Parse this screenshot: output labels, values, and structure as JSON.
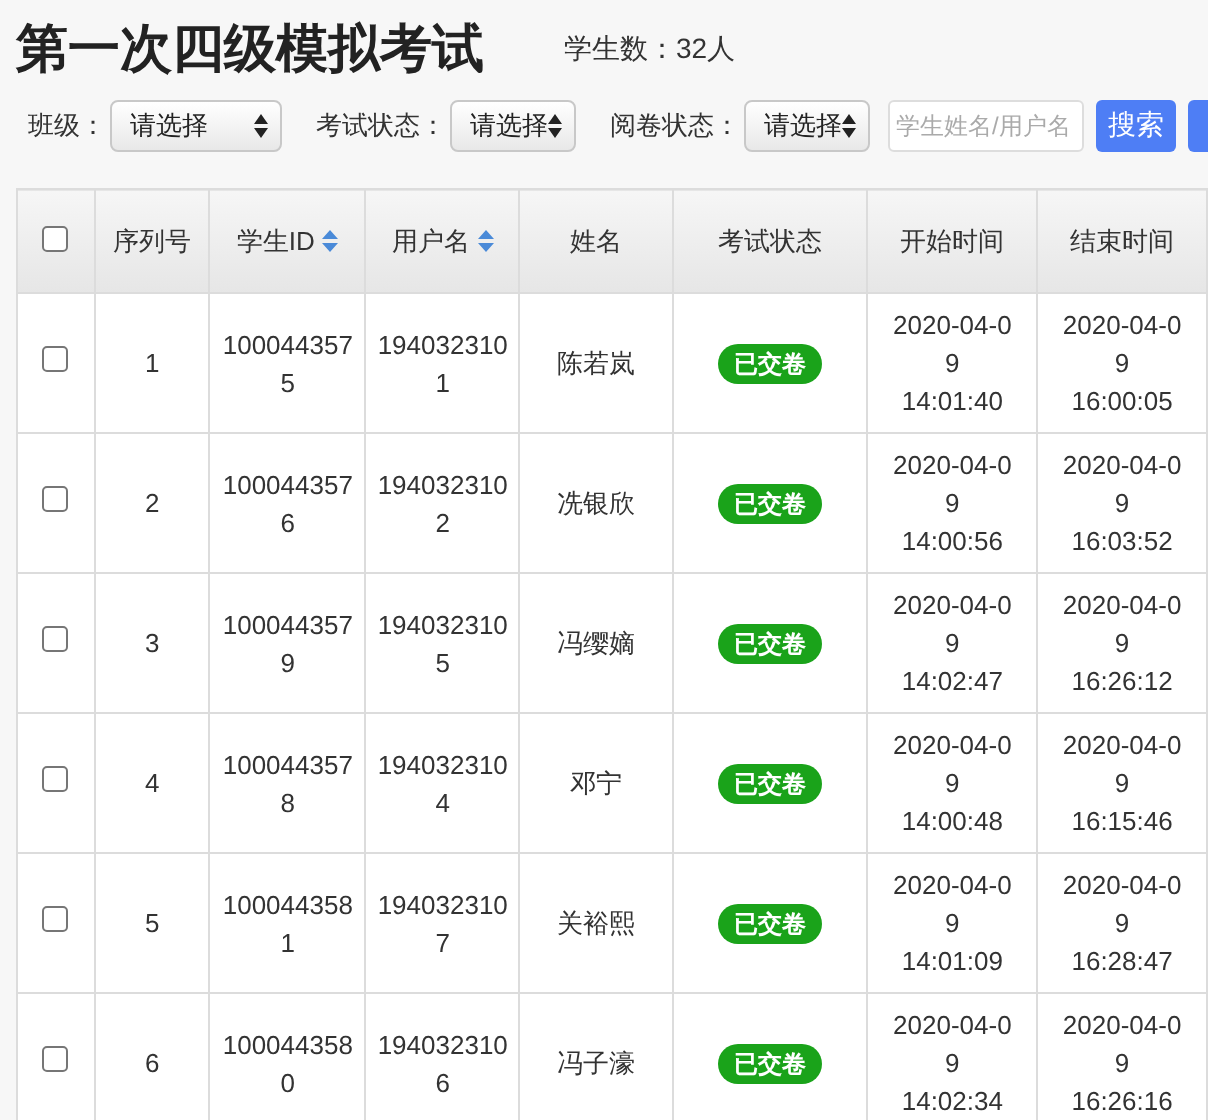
{
  "page": {
    "title": "第一次四级模拟考试",
    "student_count": "学生数：32人"
  },
  "filters": [
    {
      "label": "班级：",
      "value": "请选择"
    },
    {
      "label": "考试状态：",
      "value": "请选择"
    },
    {
      "label": "阅卷状态：",
      "value": "请选择"
    }
  ],
  "search": {
    "placeholder": "学生姓名/用户名",
    "button": "搜索"
  },
  "table": {
    "select_all_checked": false,
    "columns": [
      {
        "label": "序列号",
        "sortable": false
      },
      {
        "label": "学生ID",
        "sortable": true
      },
      {
        "label": "用户名",
        "sortable": true
      },
      {
        "label": "姓名",
        "sortable": false
      },
      {
        "label": "考试状态",
        "sortable": false
      },
      {
        "label": "开始时间",
        "sortable": false
      },
      {
        "label": "结束时间",
        "sortable": false
      }
    ],
    "rows": [
      {
        "checked": false,
        "index": "1",
        "student_id": "1000443575",
        "username": "1940323101",
        "name": "陈若岚",
        "status": "已交卷",
        "start_time": "2020-04-09 14:01:40",
        "end_time": "2020-04-09 16:00:05"
      },
      {
        "checked": false,
        "index": "2",
        "student_id": "1000443576",
        "username": "1940323102",
        "name": "冼银欣",
        "status": "已交卷",
        "start_time": "2020-04-09 14:00:56",
        "end_time": "2020-04-09 16:03:52"
      },
      {
        "checked": false,
        "index": "3",
        "student_id": "1000443579",
        "username": "1940323105",
        "name": "冯缨嫡",
        "status": "已交卷",
        "start_time": "2020-04-09 14:02:47",
        "end_time": "2020-04-09 16:26:12"
      },
      {
        "checked": false,
        "index": "4",
        "student_id": "1000443578",
        "username": "1940323104",
        "name": "邓宁",
        "status": "已交卷",
        "start_time": "2020-04-09 14:00:48",
        "end_time": "2020-04-09 16:15:46"
      },
      {
        "checked": false,
        "index": "5",
        "student_id": "1000443581",
        "username": "1940323107",
        "name": "关裕熙",
        "status": "已交卷",
        "start_time": "2020-04-09 14:01:09",
        "end_time": "2020-04-09 16:28:47"
      },
      {
        "checked": false,
        "index": "6",
        "student_id": "1000443580",
        "username": "1940323106",
        "name": "冯子濠",
        "status": "已交卷",
        "start_time": "2020-04-09 14:02:34",
        "end_time": "2020-04-09 16:26:16"
      }
    ]
  }
}
